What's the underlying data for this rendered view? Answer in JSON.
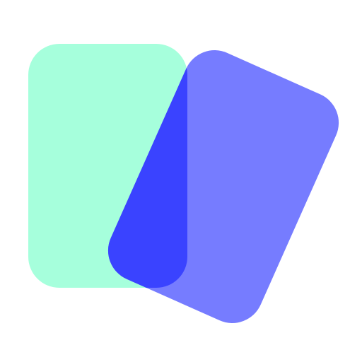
{
  "logo": {
    "icon": "two-overlapping-cards-icon",
    "colors": {
      "background": "#ffffff",
      "back_card": "#A6FFDC",
      "front_card": "#767CFF",
      "overlap": "#3A43FF"
    }
  }
}
